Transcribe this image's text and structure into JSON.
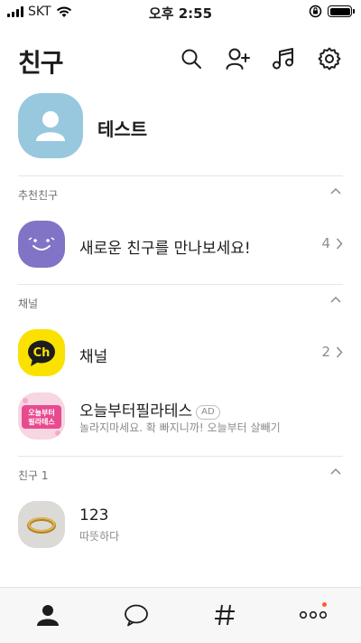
{
  "status_bar": {
    "carrier": "SKT",
    "time": "오후 2:55"
  },
  "header": {
    "title": "친구"
  },
  "profile": {
    "name": "테스트"
  },
  "sections": {
    "recommended": {
      "label": "추천친구"
    },
    "channels": {
      "label": "채널"
    },
    "friends": {
      "label": "친구 1"
    }
  },
  "recommended": {
    "label": "새로운 친구를 만나보세요!",
    "count": "4"
  },
  "channel": {
    "label": "채널",
    "count": "2"
  },
  "ad": {
    "name": "오늘부터필라테스",
    "badge": "AD",
    "description": "놀라지마세요. 확 빠지니까! 오늘부터 살빼기",
    "logo_text": "오늘부터 필라테스"
  },
  "friend": {
    "name": "123",
    "status": "따뜻하다"
  },
  "colors": {
    "accent_yellow": "#fae100",
    "purple": "#8173c6",
    "avatar_blue": "#97c8de",
    "notify": "#ff5a2c"
  },
  "icons": [
    "search-icon",
    "add-friend-icon",
    "music-icon",
    "settings-icon",
    "person-icon",
    "chat-icon",
    "hashtag-icon",
    "more-icon",
    "chevron-up-icon",
    "chevron-right-icon"
  ]
}
